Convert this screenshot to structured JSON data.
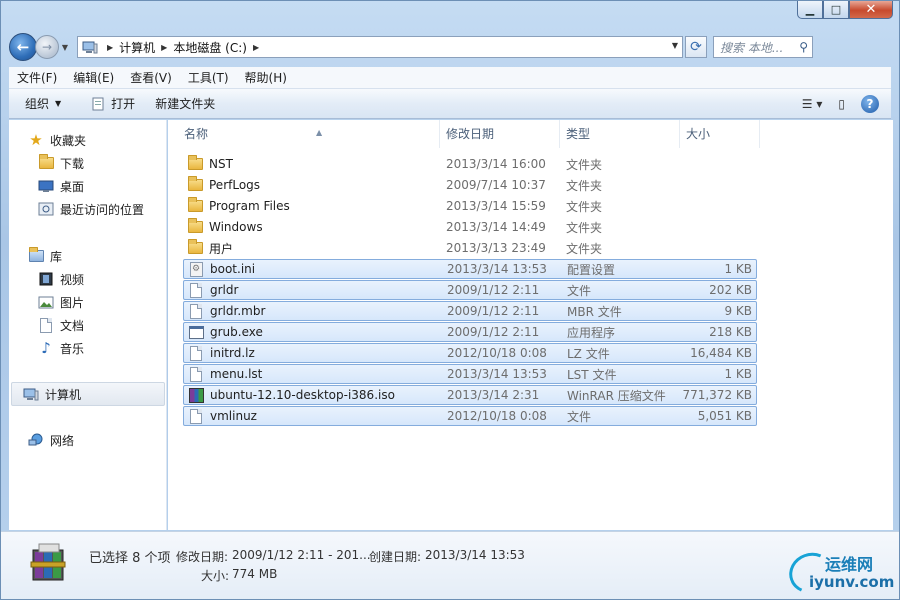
{
  "window": {
    "min_glyph": "▁",
    "max_glyph": "□",
    "close_glyph": "✕"
  },
  "address": {
    "crumbs": [
      "计算机",
      "本地磁盘 (C:)"
    ]
  },
  "search": {
    "placeholder": "搜索 本地..."
  },
  "menu": [
    "文件(F)",
    "编辑(E)",
    "查看(V)",
    "工具(T)",
    "帮助(H)"
  ],
  "commands": {
    "organize": "组织",
    "open": "打开",
    "new_folder": "新建文件夹"
  },
  "nav": {
    "favorites": "收藏夹",
    "downloads": "下载",
    "desktop": "桌面",
    "recent": "最近访问的位置",
    "libraries": "库",
    "videos": "视频",
    "pictures": "图片",
    "documents": "文档",
    "music": "音乐",
    "computer": "计算机",
    "network": "网络"
  },
  "columns": {
    "name": "名称",
    "date": "修改日期",
    "type": "类型",
    "size": "大小"
  },
  "files": [
    {
      "name": "NST",
      "date": "2013/3/14 16:00",
      "type": "文件夹",
      "size": "",
      "icon": "folder-icon",
      "selected": false
    },
    {
      "name": "PerfLogs",
      "date": "2009/7/14 10:37",
      "type": "文件夹",
      "size": "",
      "icon": "folder-icon",
      "selected": false
    },
    {
      "name": "Program Files",
      "date": "2013/3/14 15:59",
      "type": "文件夹",
      "size": "",
      "icon": "folder-icon",
      "selected": false
    },
    {
      "name": "Windows",
      "date": "2013/3/14 14:49",
      "type": "文件夹",
      "size": "",
      "icon": "folder-icon",
      "selected": false
    },
    {
      "name": "用户",
      "date": "2013/3/13 23:49",
      "type": "文件夹",
      "size": "",
      "icon": "folder-icon",
      "selected": false
    },
    {
      "name": "boot.ini",
      "date": "2013/3/14 13:53",
      "type": "配置设置",
      "size": "1 KB",
      "icon": "config-file-icon",
      "selected": true
    },
    {
      "name": "grldr",
      "date": "2009/1/12 2:11",
      "type": "文件",
      "size": "202 KB",
      "icon": "file-icon",
      "selected": true
    },
    {
      "name": "grldr.mbr",
      "date": "2009/1/12 2:11",
      "type": "MBR 文件",
      "size": "9 KB",
      "icon": "file-icon",
      "selected": true
    },
    {
      "name": "grub.exe",
      "date": "2009/1/12 2:11",
      "type": "应用程序",
      "size": "218 KB",
      "icon": "exe-icon",
      "selected": true
    },
    {
      "name": "initrd.lz",
      "date": "2012/10/18 0:08",
      "type": "LZ 文件",
      "size": "16,484 KB",
      "icon": "file-icon",
      "selected": true
    },
    {
      "name": "menu.lst",
      "date": "2013/3/14 13:53",
      "type": "LST 文件",
      "size": "1 KB",
      "icon": "file-icon",
      "selected": true
    },
    {
      "name": "ubuntu-12.10-desktop-i386.iso",
      "date": "2013/3/14 2:31",
      "type": "WinRAR 压缩文件",
      "size": "771,372 KB",
      "icon": "winrar-archive-icon",
      "selected": true
    },
    {
      "name": "vmlinuz",
      "date": "2012/10/18 0:08",
      "type": "文件",
      "size": "5,051 KB",
      "icon": "file-icon",
      "selected": true
    }
  ],
  "status": {
    "selected_count": "已选择 8 个项",
    "modified_label": "修改日期:",
    "modified_value": "2009/1/12 2:11 - 201...",
    "created_label": "创建日期:",
    "created_value": "2013/3/14 13:53",
    "size_label": "大小:",
    "size_value": "774 MB"
  },
  "watermark": {
    "cn": "运维网",
    "en": "iyunv.com"
  },
  "colors": {
    "selection_bg": "#d6e7fb",
    "selection_border": "#84acdd",
    "link_blue": "#1e5aa8"
  }
}
